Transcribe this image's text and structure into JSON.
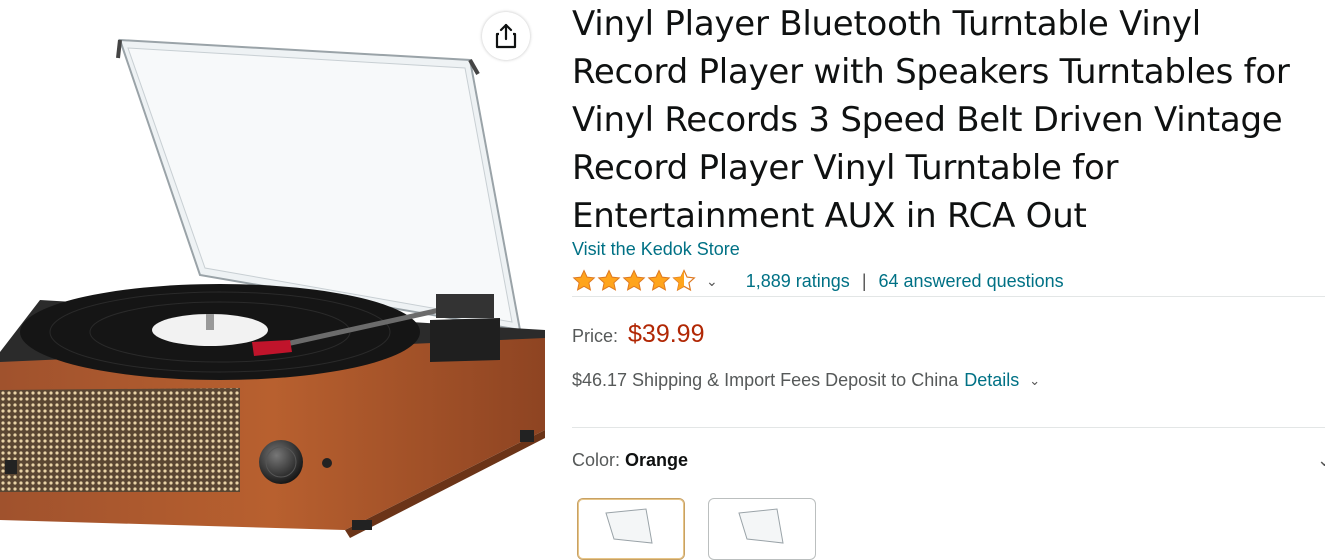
{
  "product": {
    "title": "Vinyl Player Bluetooth Turntable Vinyl Record Player with Speakers Turntables for Vinyl Records 3 Speed Belt Driven Vintage Record Player Vinyl Turntable for Entertainment AUX in RCA Out",
    "store_link": "Visit the Kedok Store",
    "rating": 4.5,
    "ratings_count": "1,889 ratings",
    "separator": "|",
    "answered_questions": "64 answered questions",
    "price_label": "Price:",
    "price": "$39.99",
    "shipping_text": "$46.17 Shipping & Import Fees Deposit to China",
    "details_link": "Details",
    "color_label": "Color:",
    "color_value": "Orange"
  },
  "icons": {
    "share": "share-icon",
    "chevron": "chevron-down-icon",
    "star": "star-icon"
  },
  "colors": {
    "link": "#007185",
    "price": "#b12704",
    "star": "#ffa41c",
    "text": "#0f1111",
    "muted": "#565959"
  }
}
